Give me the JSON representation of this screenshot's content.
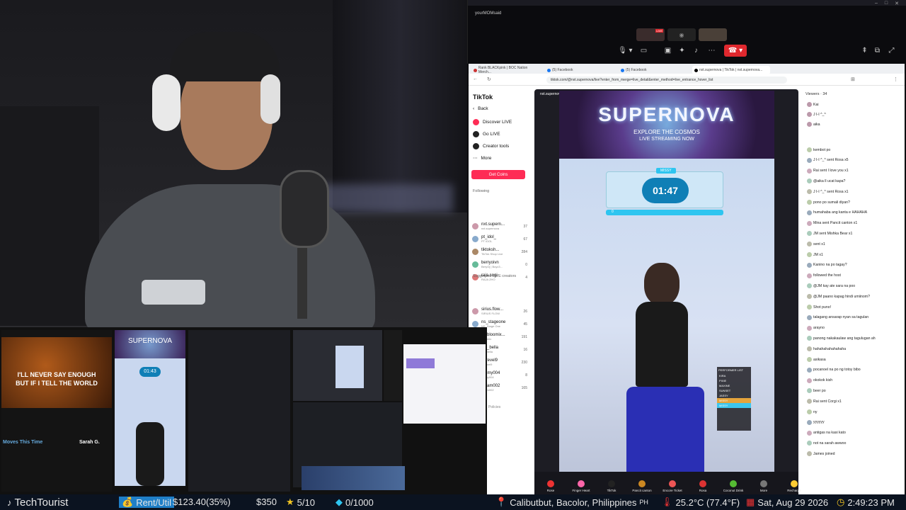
{
  "call": {
    "title": "yourMOMsaid",
    "participant_badge": "LIVE"
  },
  "browser": {
    "tabs": [
      "Rank BLACKpink | BOC Nation Merch...",
      "(5) Facebook",
      "(5) Facebook",
      "nxt.supernova | TikTok | nxt.supernova..."
    ],
    "url": "tiktok.com/@nxt.supernova/live?enter_from_merge=live_detail&enter_method=live_entrance_hover_list"
  },
  "tiktok": {
    "logo": "TikTok",
    "nav": [
      "Back",
      "Discover LIVE",
      "Go LIVE",
      "Creator tools",
      "More"
    ],
    "get_coins": "Get Coins",
    "following_title": "Following",
    "following": [
      {
        "name": "nxt.supern...",
        "sub": "nxt.supernova",
        "count": "37"
      },
      {
        "name": "pt_idol_",
        "sub": "PT IDOL",
        "count": "67"
      },
      {
        "name": "tiktoksh...",
        "sub": "TikTok Shop Live",
        "count": "284"
      },
      {
        "name": "berryoivn",
        "sub": "BeryOj | Boyc3...",
        "count": "0"
      },
      {
        "name": "raja.sogi",
        "sub": "RAJA ZHO",
        "count": "4"
      }
    ],
    "suggested_title": "Suggested LIVE creators",
    "suggested": [
      {
        "name": "sirius.flow...",
        "sub": "SIRIUS FLOW",
        "count": "26"
      },
      {
        "name": "ns_stageone",
        "sub": "NS_Stage One",
        "count": "45"
      },
      {
        "name": "oc.bloomix...",
        "sub": "Bloomix",
        "count": "191"
      },
      {
        "name": "typ_bella",
        "sub": "typ_bella",
        "count": "16"
      },
      {
        "name": "d_revel9",
        "sub": "d_revel9",
        "count": "230"
      },
      {
        "name": "gn.my004",
        "sub": "gn.my004",
        "count": "8"
      },
      {
        "name": "xteam002",
        "sub": "xteam002",
        "count": "165"
      }
    ],
    "policies": "Policies"
  },
  "stream": {
    "host": "nxt.supernova",
    "banner_title": "SUPERNOVA",
    "banner_sub1": "EXPLORE THE COSMOS",
    "banner_sub2": "LIVE STREAMING NOW",
    "performer": "MISSY",
    "timer": "01:47",
    "score": "0",
    "performer_list_title": "PERFORMER LIST",
    "performer_list": [
      "KIRA",
      "PIXIE",
      "MAXINE",
      "SUNSET",
      "JASSY",
      "MISSY",
      "MISSY"
    ],
    "gifts": [
      "Rose",
      "Finger Heart",
      "TikTok",
      "Pancit canton",
      "Encore Ticket",
      "Rosa",
      "Coconut Drink",
      "More",
      "Recharge"
    ]
  },
  "chat": {
    "viewers_label": "Viewers · 34",
    "viewers": [
      "Kai",
      "J I-I  ^_^",
      "aika"
    ],
    "messages": [
      "kembot po",
      "J I-I  ^_^ sent Rosa x5",
      "Rai sent I love you x1",
      "@aika ll ucat kapa?",
      "J I-I  ^_^ sent Rosa x1",
      "pono po sumali diyan?",
      "humahaba ang kanta e HAHAHA",
      "Mina sent Pancit canton x1",
      "JM sent Mishka Bear x1",
      "sent x1",
      "JM x1",
      "Kanino na po tagay?",
      "followed the host",
      "@JM kay ate sara na poo",
      "@JM paano kapag hindi umiinom?",
      "Shot puno!",
      "talagang ansarap nyan sa tagulan",
      "arayno",
      "panong nakakaulaw ang tagulugan ah",
      "hahahahahahahaha",
      "asikasa",
      "pocanoel na po ng totoy bibo",
      "okokok kish",
      "beer po",
      "Rai sent Corgi x1",
      "ny",
      "yyyyyy",
      "antigas na kasi kato",
      "not na sarah awwoo",
      "James joined"
    ]
  },
  "thumbs": {
    "lyric1": "I'LL NEVER SAY ENOUGH",
    "lyric2": "BUT IF I TELL THE WORLD",
    "yt_title": "Moves This Time",
    "yt_artist": "Sarah G.",
    "mini_timer": "01:43"
  },
  "statusbar": {
    "channel": "TechTourist",
    "goal_label": "Rent/Util",
    "goal_amount": "$123.40(35%)",
    "goal_target": "$350",
    "stars": "5/10",
    "gems": "0/1000",
    "location": "Calibutbut, Bacolor, Philippines",
    "country": "PH",
    "weather": "25.2°C (77.4°F)",
    "date": "Sat, Aug 29 2026",
    "time": "2:49:23 PM"
  },
  "colors": {
    "tiktok_red": "#fe2c55",
    "status_bg": "#0b1320",
    "cyan": "#2ec5f0",
    "call_hangup": "#e0282e"
  }
}
